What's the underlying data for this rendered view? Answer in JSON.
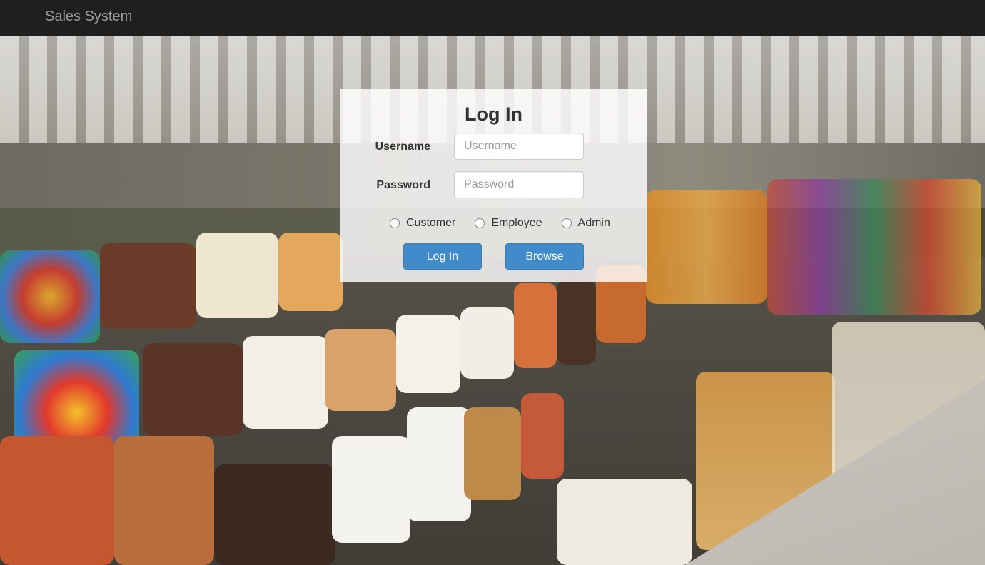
{
  "navbar": {
    "brand": "Sales System"
  },
  "login": {
    "title": "Log In",
    "username_label": "Username",
    "username_placeholder": "Username",
    "username_value": "",
    "password_label": "Password",
    "password_placeholder": "Password",
    "password_value": "",
    "roles": [
      {
        "label": "Customer",
        "selected": false
      },
      {
        "label": "Employee",
        "selected": false
      },
      {
        "label": "Admin",
        "selected": false
      }
    ],
    "login_button": "Log In",
    "browse_button": "Browse"
  },
  "colors": {
    "navbar_bg": "#1f1f1f",
    "brand_text": "#9d9d9d",
    "primary_button": "#428bca",
    "panel_bg": "rgba(255,255,255,0.82)"
  },
  "background": {
    "image": "bulk-candy-store-photo"
  }
}
